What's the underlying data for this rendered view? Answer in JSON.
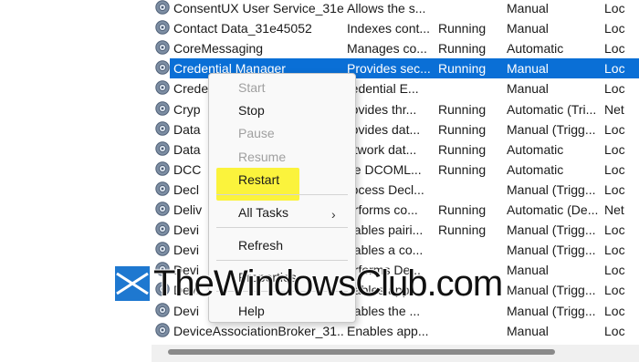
{
  "colors": {
    "selection": "#0a6fd6",
    "highlight": "#fbf33c",
    "watermark_logo": "#1e78d0"
  },
  "services": [
    {
      "name": "ConsentUX User Service_31e...",
      "description": "Allows the s...",
      "status": "",
      "startup": "Manual",
      "logon": "Loc"
    },
    {
      "name": "Contact Data_31e45052",
      "description": "Indexes cont...",
      "status": "Running",
      "startup": "Manual",
      "logon": "Loc"
    },
    {
      "name": "CoreMessaging",
      "description": "Manages co...",
      "status": "Running",
      "startup": "Automatic",
      "logon": "Loc"
    },
    {
      "name": "Credential Manager",
      "description": "Provides sec...",
      "status": "Running",
      "startup": "Manual",
      "logon": "Loc",
      "selected": true
    },
    {
      "name": "Crede",
      "description": "redential E...",
      "status": "",
      "startup": "Manual",
      "logon": "Loc"
    },
    {
      "name": "Cryp",
      "description": "rovides thr...",
      "status": "Running",
      "startup": "Automatic (Tri...",
      "logon": "Net"
    },
    {
      "name": "Data",
      "description": "rovides dat...",
      "status": "Running",
      "startup": "Manual (Trigg...",
      "logon": "Loc"
    },
    {
      "name": "Data",
      "description": "etwork dat...",
      "status": "Running",
      "startup": "Automatic",
      "logon": "Loc"
    },
    {
      "name": "DCC",
      "description": "he DCOML...",
      "status": "Running",
      "startup": "Automatic",
      "logon": "Loc"
    },
    {
      "name": "Decl",
      "description": "rocess Decl...",
      "status": "",
      "startup": "Manual (Trigg...",
      "logon": "Loc"
    },
    {
      "name": "Deliv",
      "description": "erforms co...",
      "status": "Running",
      "startup": "Automatic (De...",
      "logon": "Net"
    },
    {
      "name": "Devi",
      "description": "nables pairi...",
      "status": "Running",
      "startup": "Manual (Trigg...",
      "logon": "Loc"
    },
    {
      "name": "Devi",
      "description": "nables a co...",
      "status": "",
      "startup": "Manual (Trigg...",
      "logon": "Loc"
    },
    {
      "name": "Devi",
      "description": "erforms De...",
      "status": "",
      "startup": "Manual",
      "logon": "Loc"
    },
    {
      "name": "Devi",
      "description": "nables app...",
      "status": "",
      "startup": "Manual (Trigg...",
      "logon": "Loc"
    },
    {
      "name": "Devi",
      "description": "nables the ...",
      "status": "",
      "startup": "Manual (Trigg...",
      "logon": "Loc"
    },
    {
      "name": "DeviceAssociationBroker_31...",
      "description": "Enables app...",
      "status": "",
      "startup": "Manual",
      "logon": "Loc"
    }
  ],
  "context_menu": {
    "start": "Start",
    "stop": "Stop",
    "pause": "Pause",
    "resume": "Resume",
    "restart": "Restart",
    "all_tasks": "All Tasks",
    "refresh": "Refresh",
    "properties": "Properties",
    "help": "Help"
  },
  "watermark": {
    "text": "TheWindowsClub.com"
  }
}
